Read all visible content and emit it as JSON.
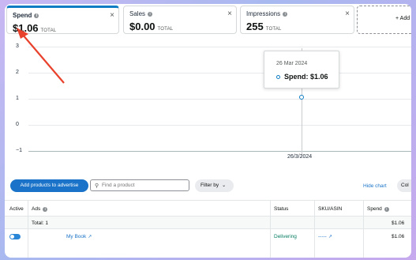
{
  "metrics": [
    {
      "name": "Spend",
      "value": "$1.06",
      "unit": "TOTAL"
    },
    {
      "name": "Sales",
      "value": "$0.00",
      "unit": "TOTAL"
    },
    {
      "name": "Impressions",
      "value": "255",
      "unit": "TOTAL"
    }
  ],
  "add_metric_label": "+ Add",
  "chart_data": {
    "type": "line",
    "title": "",
    "xlabel": "",
    "ylabel": "",
    "y_ticks": [
      "3",
      "2",
      "1",
      "0",
      "−1"
    ],
    "ylim": [
      -1,
      3
    ],
    "x_ticks": [
      "26/3/2024"
    ],
    "series": [
      {
        "values": [
          1.06
        ]
      }
    ],
    "x": [
      "26/3/2024"
    ],
    "grid": true,
    "tooltip": {
      "date": "26 Mar 2024",
      "label": "Spend: $1.06"
    }
  },
  "colors": {
    "accent": "#1a73c8",
    "status_green": "#067d62"
  },
  "toolbar": {
    "add_products": "Add products to advertise",
    "search_placeholder": "Find a product",
    "filter": "Filter by",
    "hide_chart": "Hide chart",
    "columns": "Col"
  },
  "table": {
    "headers": {
      "active": "Active",
      "ads": "Ads",
      "status": "Status",
      "sku": "SKU/ASIN",
      "spend": "Spend"
    },
    "total_label": "Total: 1",
    "total_spend": "$1.06",
    "rows": [
      {
        "ad": "My Book",
        "status": "Delivering",
        "sku": "-----",
        "spend": "$1.06",
        "active": true
      }
    ]
  }
}
